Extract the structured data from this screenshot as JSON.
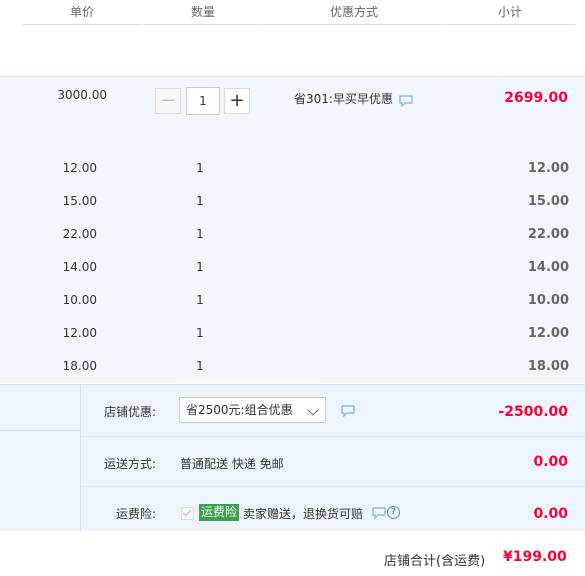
{
  "header": {
    "unit_price": "单价",
    "quantity": "数量",
    "discount_method": "优惠方式",
    "subtotal": "小计"
  },
  "main_item": {
    "price": "3000.00",
    "quantity": "1",
    "minus": "−",
    "plus": "+",
    "promotion": "省301:早买早优惠",
    "subtotal": "2699.00"
  },
  "bundle_items": [
    {
      "price": "12.00",
      "quantity": "1",
      "subtotal": "12.00"
    },
    {
      "price": "15.00",
      "quantity": "1",
      "subtotal": "15.00"
    },
    {
      "price": "22.00",
      "quantity": "1",
      "subtotal": "22.00"
    },
    {
      "price": "14.00",
      "quantity": "1",
      "subtotal": "14.00"
    },
    {
      "price": "10.00",
      "quantity": "1",
      "subtotal": "10.00"
    },
    {
      "price": "12.00",
      "quantity": "1",
      "subtotal": "12.00"
    },
    {
      "price": "18.00",
      "quantity": "1",
      "subtotal": "18.00"
    }
  ],
  "store_discount": {
    "label": "店铺优惠:",
    "selected": "省2500元:组合优惠",
    "amount": "-2500.00"
  },
  "shipping": {
    "label": "运送方式:",
    "method": "普通配送 快递 免邮",
    "amount": "0.00"
  },
  "insurance": {
    "label": "运费险:",
    "badge": "运费险",
    "text": "卖家赠送，退换货可赔",
    "help": "?",
    "amount": "0.00"
  },
  "total": {
    "label": "店铺合计(含运费)",
    "amount": "¥199.00"
  },
  "colors": {
    "accent_red": "#ff0036",
    "panel_bg": "#f2f7ff",
    "badge_green": "#3aa34a",
    "icon_blue": "#4e8ecf"
  }
}
